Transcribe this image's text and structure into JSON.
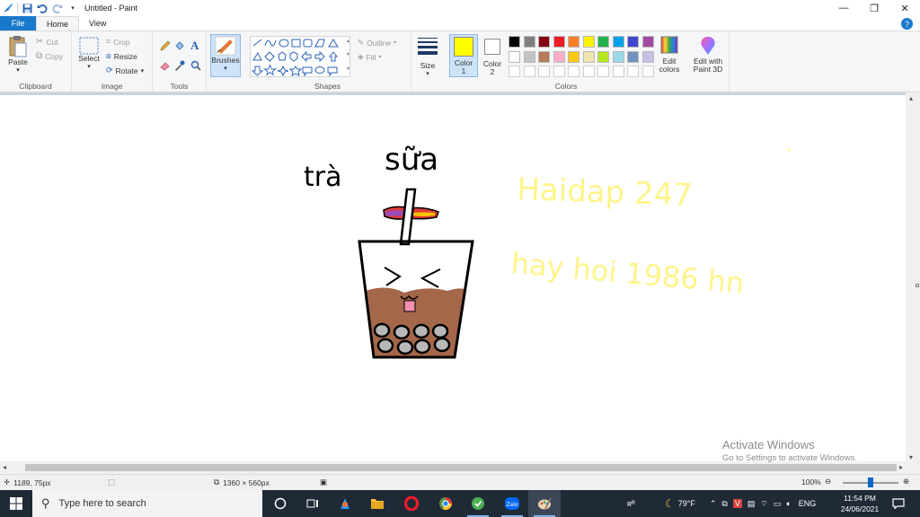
{
  "window": {
    "title": "Untitled - Paint",
    "minimize": "—",
    "maximize": "❐",
    "close": "✕"
  },
  "tabs": {
    "file": "File",
    "home": "Home",
    "view": "View"
  },
  "clipboard": {
    "paste": "Paste",
    "cut": "Cut",
    "copy": "Copy",
    "label": "Clipboard"
  },
  "image": {
    "select": "Select",
    "crop": "Crop",
    "resize": "Resize",
    "rotate": "Rotate",
    "label": "Image"
  },
  "tools": {
    "label": "Tools"
  },
  "brushes": {
    "label": "Brushes"
  },
  "shapes": {
    "outline": "Outline",
    "fill": "Fill",
    "label": "Shapes"
  },
  "size": {
    "label": "Size"
  },
  "color1": {
    "label": "Color",
    "num": "1",
    "value": "#ffff00"
  },
  "color2": {
    "label": "Color",
    "num": "2",
    "value": "#ffffff"
  },
  "colors": {
    "label": "Colors",
    "palette_row1": [
      "#000000",
      "#7f7f7f",
      "#880015",
      "#ed1c24",
      "#ff7f27",
      "#fff200",
      "#22b14c",
      "#00a2e8",
      "#3f48cc",
      "#a349a4"
    ],
    "palette_row2": [
      "#ffffff",
      "#c3c3c3",
      "#b97a57",
      "#ffaec9",
      "#ffc90e",
      "#efe4b0",
      "#b5e61d",
      "#99d9ea",
      "#7092be",
      "#c8bfe7"
    ]
  },
  "edit_colors": {
    "line1": "Edit",
    "line2": "colors"
  },
  "paint3d": {
    "line1": "Edit with",
    "line2": "Paint 3D"
  },
  "drawing": {
    "text_tra": "trà",
    "text_sua": "sữa",
    "yellow_line1": "Haidap 247",
    "yellow_line2": "hay hoi 1986 hn"
  },
  "watermark": {
    "line1": "Activate Windows",
    "line2": "Go to Settings to activate Windows."
  },
  "status": {
    "cursor": "1189, 75px",
    "dimensions": "1360 × 560px",
    "zoom": "100%"
  },
  "taskbar": {
    "search_placeholder": "Type here to search",
    "weather": "79°F",
    "lang": "ENG",
    "time": "11:54 PM",
    "date": "24/06/2021",
    "rr": "ʀᴿ"
  }
}
